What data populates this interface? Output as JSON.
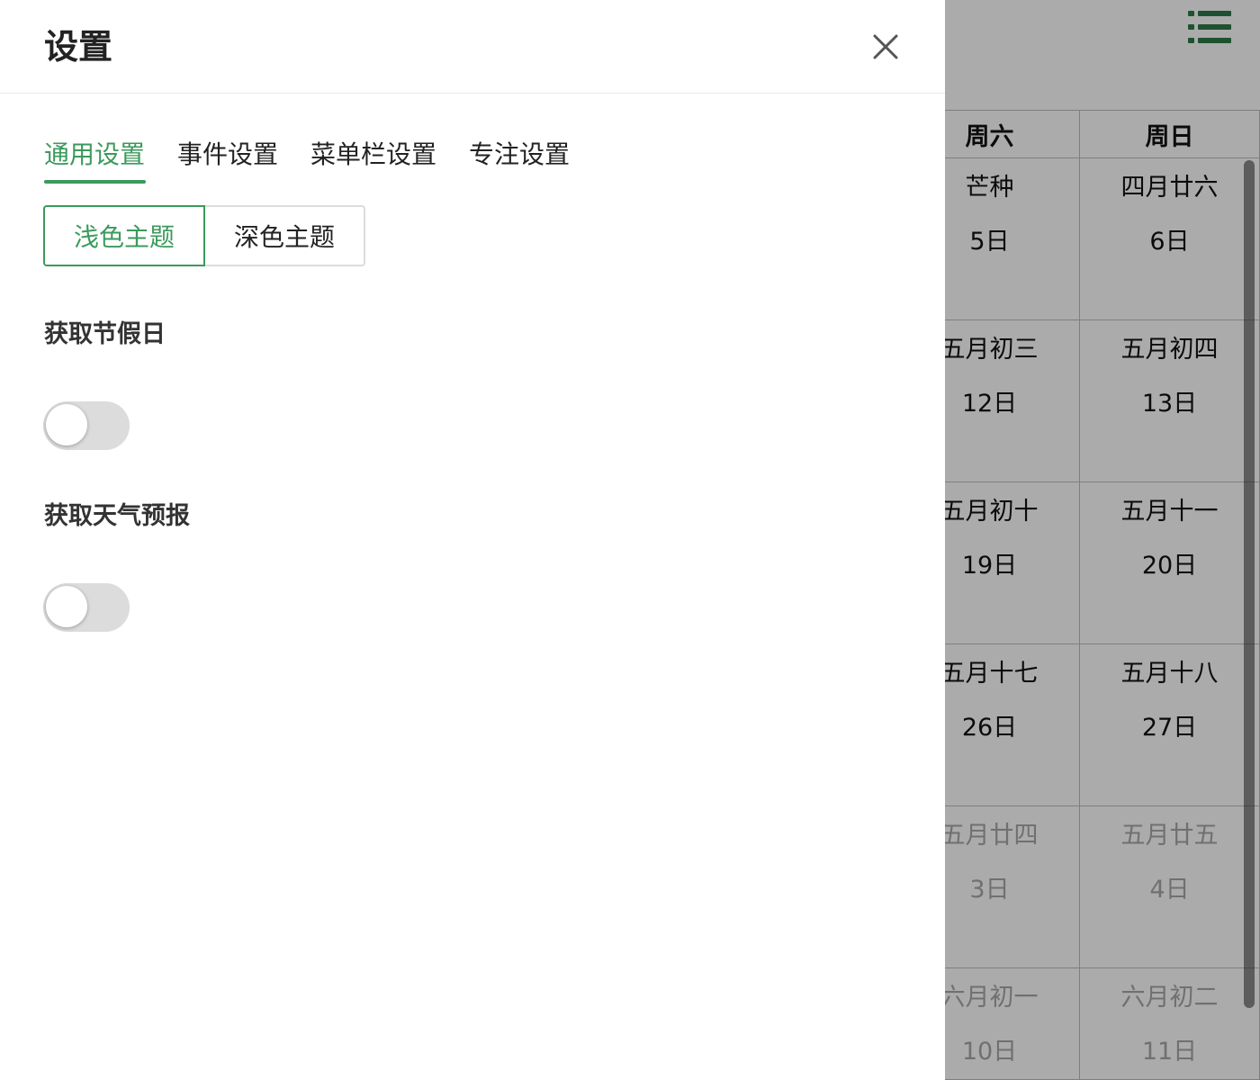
{
  "calendar": {
    "list_icon": "list-icon",
    "weekday_headers": [
      "周六",
      "周日"
    ],
    "cells": [
      {
        "lunar": "芒种",
        "solar": "5日"
      },
      {
        "lunar": "四月廿六",
        "solar": "6日"
      },
      {
        "lunar": "五月初三",
        "solar": "12日"
      },
      {
        "lunar": "五月初四",
        "solar": "13日"
      },
      {
        "lunar": "五月初十",
        "solar": "19日"
      },
      {
        "lunar": "五月十一",
        "solar": "20日"
      },
      {
        "lunar": "五月十七",
        "solar": "26日"
      },
      {
        "lunar": "五月十八",
        "solar": "27日"
      },
      {
        "lunar": "五月廿四",
        "solar": "3日"
      },
      {
        "lunar": "五月廿五",
        "solar": "4日"
      },
      {
        "lunar": "六月初一",
        "solar": "10日"
      },
      {
        "lunar": "六月初二",
        "solar": "11日"
      }
    ]
  },
  "settings": {
    "title": "设置",
    "close_icon": "close-icon",
    "tabs": [
      {
        "label": "通用设置",
        "active": true
      },
      {
        "label": "事件设置",
        "active": false
      },
      {
        "label": "菜单栏设置",
        "active": false
      },
      {
        "label": "专注设置",
        "active": false
      }
    ],
    "theme": {
      "light_label": "浅色主题",
      "dark_label": "深色主题",
      "selected": "light"
    },
    "holidays": {
      "label": "获取节假日",
      "enabled": false
    },
    "weather": {
      "label": "获取天气预报",
      "enabled": false
    }
  },
  "colors": {
    "accent": "#3b9a5c",
    "calendar_icon": "#2e7a46",
    "switch_off": "#dcdcdc",
    "overlay": "rgba(0,0,0,0.33)"
  }
}
